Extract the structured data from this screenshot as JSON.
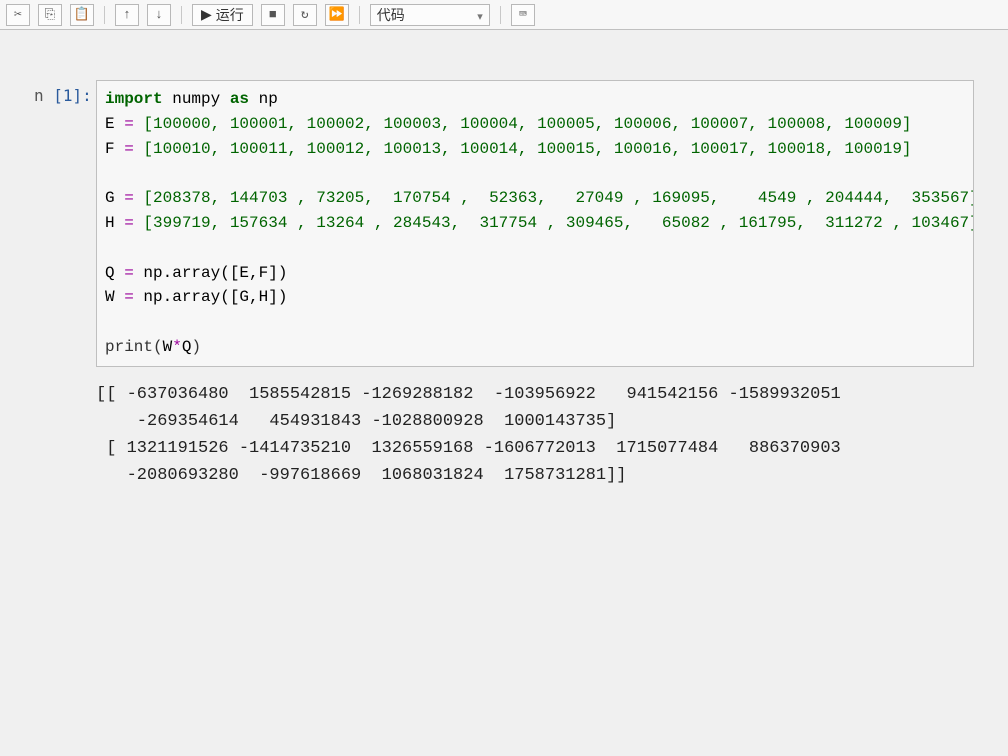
{
  "toolbar": {
    "cut_icon": "✂",
    "copy_icon": "⎘",
    "paste_icon": "📋",
    "up_icon": "↑",
    "down_icon": "↓",
    "run_icon": "▶",
    "run_label": "运行",
    "stop_icon": "■",
    "restart_icon": "↻",
    "ff_icon": "⏩",
    "cell_type": "代码",
    "keyboard_icon": "⌨"
  },
  "cell": {
    "prompt_prefix": "n",
    "prompt_label": "[1]:",
    "code": {
      "l1": {
        "import": "import",
        "numpy": " numpy ",
        "as": "as",
        "np": " np"
      },
      "l2": {
        "var": "E ",
        "eq": "= ",
        "rest": "[100000, 100001, 100002, 100003, 100004, 100005, 100006, 100007, 100008, 100009]"
      },
      "l3": {
        "var": "F ",
        "eq": "= ",
        "rest": "[100010, 100011, 100012, 100013, 100014, 100015, 100016, 100017, 100018, 100019]"
      },
      "l5": {
        "var": "G ",
        "eq": "= ",
        "rest": "[208378, 144703 , 73205,  170754 ,  52363,   27049 , 169095,    4549 , 204444,  353567]"
      },
      "l6": {
        "var": "H ",
        "eq": "= ",
        "rest": "[399719, 157634 , 13264 , 284543,  317754 , 309465,   65082 , 161795,  311272 , 103467]"
      },
      "l8": {
        "var": "Q ",
        "eq": "= ",
        "rest": "np.array([E,F])"
      },
      "l9": {
        "var": "W ",
        "eq": "= ",
        "rest": "np.array([G,H])"
      },
      "l11": {
        "print": "print",
        "open": "(",
        "w": "W",
        "star": "*",
        "q": "Q",
        "close": ")"
      }
    }
  },
  "output": {
    "line1": "[[ -637036480  1585542815 -1269288182  -103956922   941542156 -1589932051",
    "line2": "    -269354614   454931843 -1028800928  1000143735]",
    "line3": " [ 1321191526 -1414735210  1326559168 -1606772013  1715077484   886370903",
    "line4": "   -2080693280  -997618669  1068031824  1758731281]]"
  }
}
